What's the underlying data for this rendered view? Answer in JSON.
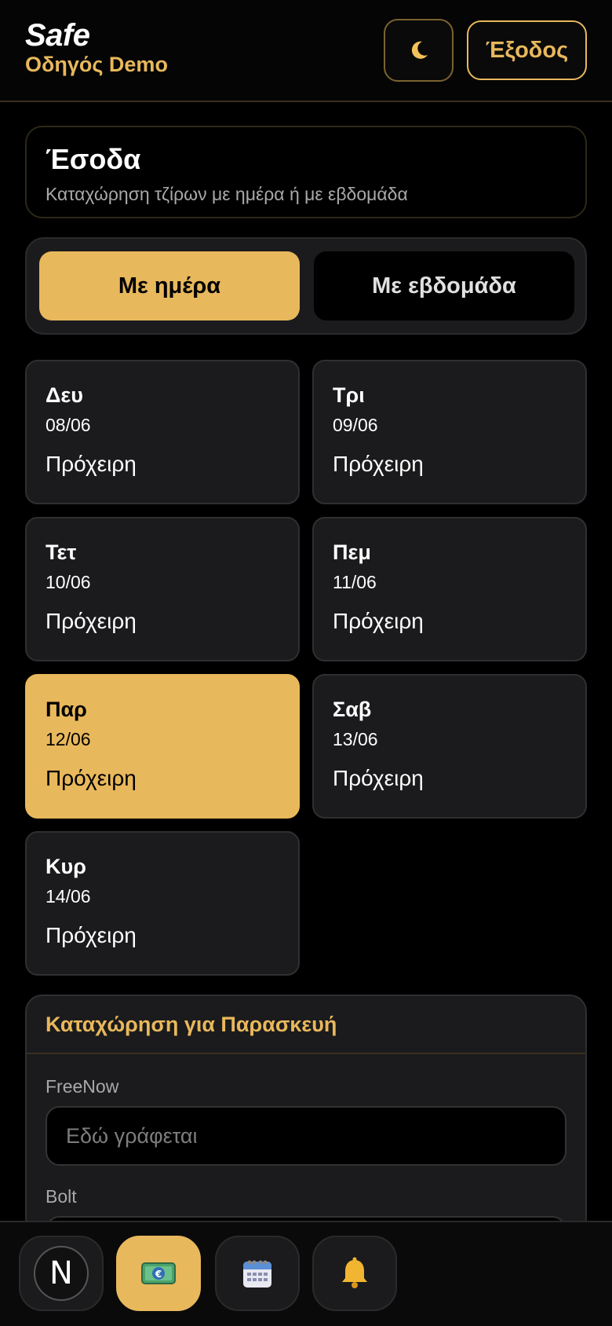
{
  "header": {
    "app_name": "Safe",
    "user_label": "Οδηγός Demo",
    "theme_icon": "🌙",
    "logout_label": "Έξοδος"
  },
  "page": {
    "title": "Έσοδα",
    "subtitle": "Καταχώρηση τζίρων με ημέρα ή με εβδομάδα"
  },
  "mode_toggle": {
    "by_day": "Με ημέρα",
    "by_week": "Με εβδομάδα",
    "selected": "by_day"
  },
  "days": [
    {
      "name": "Δευ",
      "date": "08/06",
      "status": "Πρόχειρη",
      "active": false
    },
    {
      "name": "Τρι",
      "date": "09/06",
      "status": "Πρόχειρη",
      "active": false
    },
    {
      "name": "Τετ",
      "date": "10/06",
      "status": "Πρόχειρη",
      "active": false
    },
    {
      "name": "Πεμ",
      "date": "11/06",
      "status": "Πρόχειρη",
      "active": false
    },
    {
      "name": "Παρ",
      "date": "12/06",
      "status": "Πρόχειρη",
      "active": true
    },
    {
      "name": "Σαβ",
      "date": "13/06",
      "status": "Πρόχειρη",
      "active": false
    },
    {
      "name": "Κυρ",
      "date": "14/06",
      "status": "Πρόχειρη",
      "active": false
    }
  ],
  "entry": {
    "title": "Καταχώρηση για Παρασκευή",
    "fields": [
      {
        "label": "FreeNow",
        "placeholder": "Εδώ γράφεται"
      },
      {
        "label": "Bolt",
        "placeholder": ""
      }
    ]
  },
  "bottom_nav": {
    "items": [
      {
        "name": "home",
        "icon": "N"
      },
      {
        "name": "income",
        "icon": "💶"
      },
      {
        "name": "calendar",
        "icon": "📅"
      },
      {
        "name": "notifications",
        "icon": "🔔"
      }
    ]
  },
  "colors": {
    "accent": "#e8b85c",
    "background": "#000000",
    "card": "#1b1b1d"
  }
}
